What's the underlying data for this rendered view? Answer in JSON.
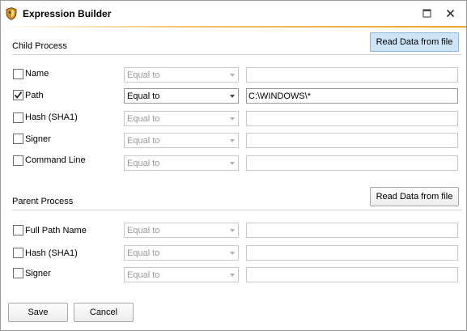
{
  "window": {
    "title": "Expression Builder"
  },
  "child_process": {
    "section_title": "Child Process",
    "read_button": "Read Data from file",
    "rows": [
      {
        "label": "Name",
        "checked": false,
        "operator": "Equal to",
        "value": ""
      },
      {
        "label": "Path",
        "checked": true,
        "operator": "Equal to",
        "value": "C:\\WINDOWS\\*"
      },
      {
        "label": "Hash (SHA1)",
        "checked": false,
        "operator": "Equal to",
        "value": ""
      },
      {
        "label": "Signer",
        "checked": false,
        "operator": "Equal to",
        "value": ""
      },
      {
        "label": "Command Line",
        "checked": false,
        "operator": "Equal to",
        "value": ""
      }
    ]
  },
  "parent_process": {
    "section_title": "Parent Process",
    "read_button": "Read Data from file",
    "rows": [
      {
        "label": "Full Path Name",
        "checked": false,
        "operator": "Equal to",
        "value": ""
      },
      {
        "label": "Hash (SHA1)",
        "checked": false,
        "operator": "Equal to",
        "value": ""
      },
      {
        "label": "Signer",
        "checked": false,
        "operator": "Equal to",
        "value": ""
      }
    ]
  },
  "footer": {
    "save_label": "Save",
    "cancel_label": "Cancel"
  },
  "colors": {
    "accent": "#f0a32b",
    "highlight_button": "#cfe4f7"
  }
}
